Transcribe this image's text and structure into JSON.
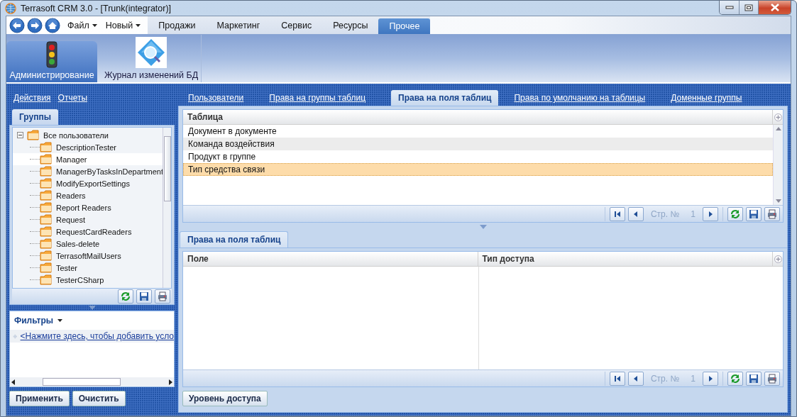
{
  "window": {
    "title": "Terrasoft CRM 3.0 - [Trunk(integrator)]"
  },
  "menu": {
    "dropdowns": [
      "Файл",
      "Новый"
    ],
    "tabs": [
      {
        "label": "Продажи",
        "selected": false
      },
      {
        "label": "Маркетинг",
        "selected": false
      },
      {
        "label": "Сервис",
        "selected": false
      },
      {
        "label": "Ресурсы",
        "selected": false
      },
      {
        "label": "Прочее",
        "selected": true
      }
    ]
  },
  "ribbon": [
    {
      "label": "Администрирование",
      "kind": "traffic-light",
      "selected": true
    },
    {
      "label": "Журнал изменений БД",
      "kind": "magnifier",
      "selected": false
    }
  ],
  "sidebar": {
    "links": [
      "Действия",
      "Отчеты"
    ],
    "tab": "Группы",
    "tree": {
      "label": "Все пользователи",
      "expanded": true,
      "selected": false,
      "children": [
        {
          "label": "DescriptionTester",
          "selected": false
        },
        {
          "label": "Manager",
          "selected": true
        },
        {
          "label": "ManagerByTasksInDepartment",
          "selected": false
        },
        {
          "label": "ModifyExportSettings",
          "selected": false
        },
        {
          "label": "Readers",
          "selected": false
        },
        {
          "label": "Report Readers",
          "selected": false
        },
        {
          "label": "Request",
          "selected": false
        },
        {
          "label": "RequestCardReaders",
          "selected": false
        },
        {
          "label": "Sales-delete",
          "selected": false
        },
        {
          "label": "TerrasoftMailUsers",
          "selected": false
        },
        {
          "label": "Tester",
          "selected": false
        },
        {
          "label": "TesterCSharp",
          "selected": false
        }
      ]
    },
    "filters": {
      "title": "Фильтры",
      "add_link": "<Нажмите здесь, чтобы добавить усло"
    },
    "buttons": [
      "Применить",
      "Очистить"
    ]
  },
  "main": {
    "tabs": [
      {
        "label": "Пользователи",
        "selected": false
      },
      {
        "label": "Права на группы таблиц",
        "selected": false
      },
      {
        "label": "Права на поля таблиц",
        "selected": true
      },
      {
        "label": "Права по умолчанию на таблицы",
        "selected": false
      },
      {
        "label": "Доменные группы",
        "selected": false
      }
    ],
    "table": {
      "columns": [
        "Таблица"
      ],
      "rows": [
        {
          "cells": [
            "Документ в документе"
          ],
          "selected": false
        },
        {
          "cells": [
            "Команда воздействия"
          ],
          "selected": false
        },
        {
          "cells": [
            "Продукт в группе"
          ],
          "selected": false
        },
        {
          "cells": [
            "Тип средства связи"
          ],
          "selected": true
        }
      ],
      "pager": {
        "label": "Стр. №",
        "page": "1"
      }
    },
    "detail": {
      "tab": "Права на поля таблиц",
      "table": {
        "columns": [
          "Поле",
          "Тип доступа"
        ],
        "pager": {
          "label": "Стр. №",
          "page": "1"
        }
      },
      "buttons": [
        "Уровень доступа"
      ]
    }
  }
}
